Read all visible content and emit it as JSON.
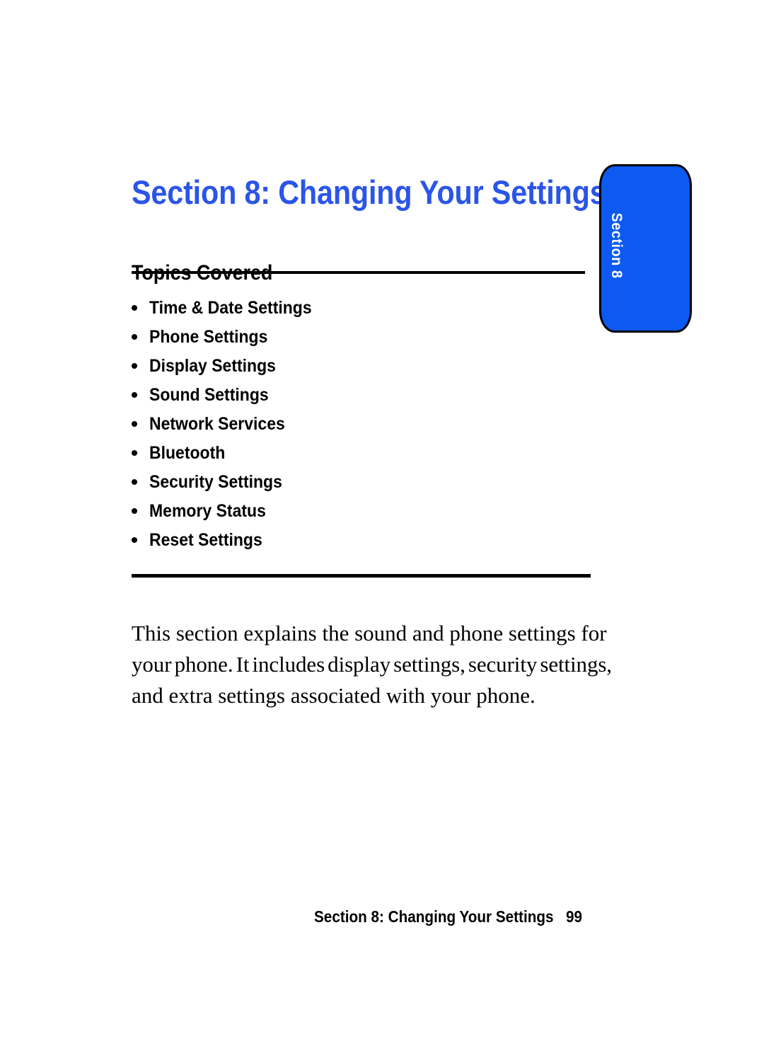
{
  "page": {
    "title": "Section 8: Changing Your Settings",
    "title_color": "#2B55E8",
    "background_color": "#ffffff"
  },
  "side_tab": {
    "label": "Section 8",
    "fill_color": "#0C5AF2",
    "border_color": "#000000",
    "text_color": "#ffffff"
  },
  "topics": {
    "heading": "Topics Covered",
    "items": [
      {
        "label": "Time & Date Settings"
      },
      {
        "label": "Phone Settings"
      },
      {
        "label": "Display Settings"
      },
      {
        "label": "Sound Settings"
      },
      {
        "label": "Network Services"
      },
      {
        "label": "Bluetooth"
      },
      {
        "label": "Security Settings"
      },
      {
        "label": "Memory Status"
      },
      {
        "label": "Reset Settings"
      }
    ]
  },
  "body": {
    "lines": [
      "This section explains the sound and phone settings for",
      "your phone. It includes display settings, security settings,",
      "and extra settings associated with your phone."
    ]
  },
  "footer": {
    "title": "Section 8: Changing Your Settings",
    "page_number": "99"
  }
}
